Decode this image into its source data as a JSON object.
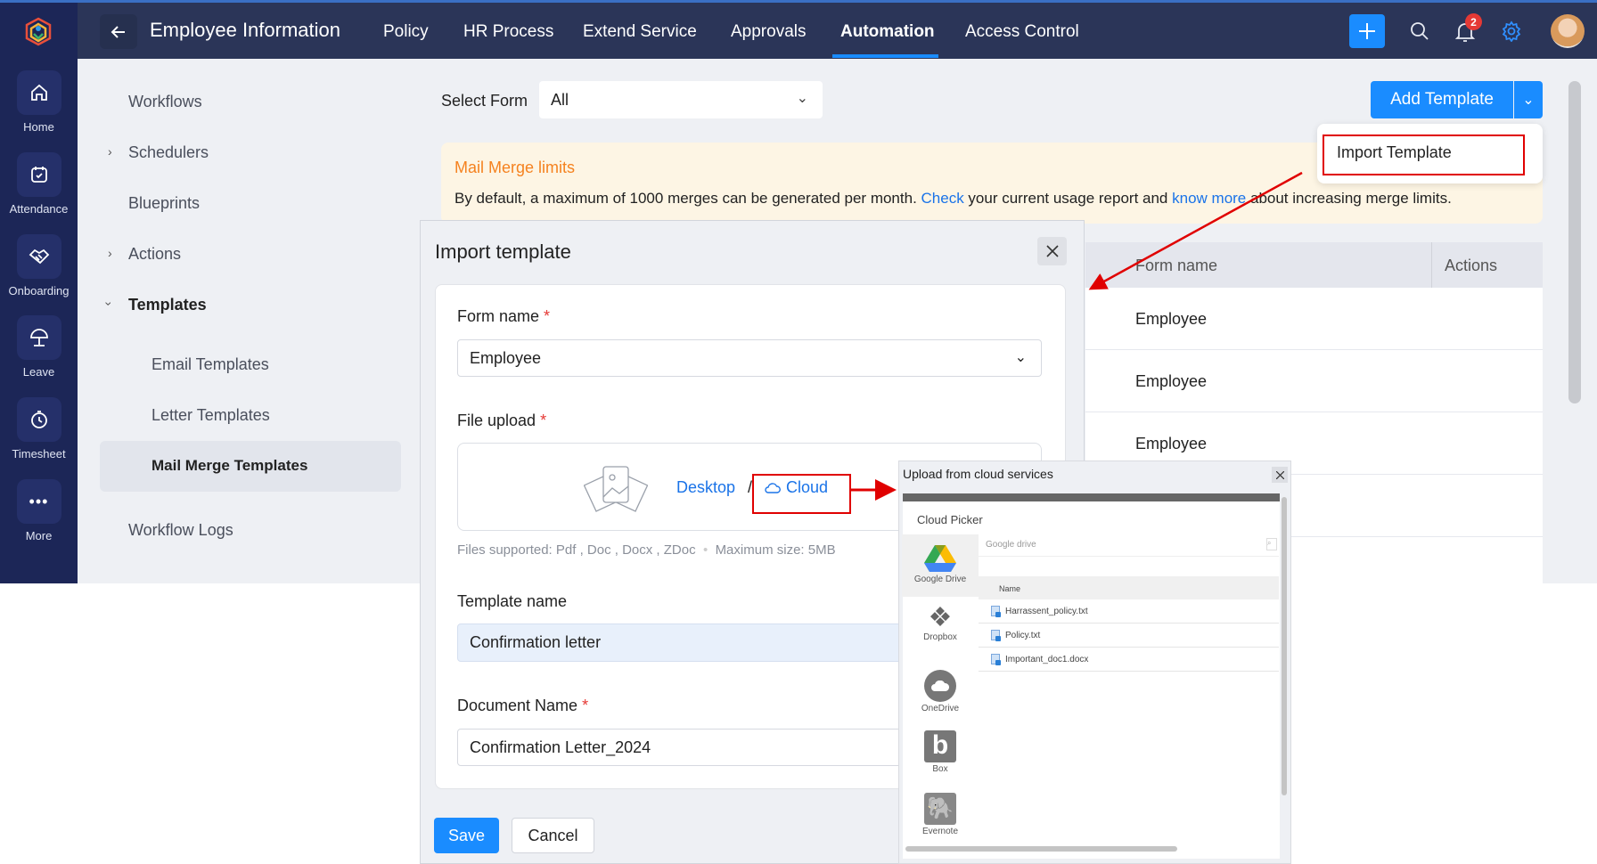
{
  "header": {
    "title": "Employee Information",
    "tabs": [
      {
        "label": "Policy"
      },
      {
        "label": "HR Process"
      },
      {
        "label": "Extend Service"
      },
      {
        "label": "Approvals"
      },
      {
        "label": "Automation",
        "active": true
      },
      {
        "label": "Access Control"
      }
    ],
    "notification_count": "2"
  },
  "rail": [
    {
      "label": "Home",
      "icon": "home-icon"
    },
    {
      "label": "Attendance",
      "icon": "calendar-check-icon"
    },
    {
      "label": "Onboarding",
      "icon": "handshake-icon"
    },
    {
      "label": "Leave",
      "icon": "umbrella-icon"
    },
    {
      "label": "Timesheet",
      "icon": "timer-icon"
    },
    {
      "label": "More",
      "icon": "more-icon"
    }
  ],
  "sidebar": {
    "items": [
      {
        "label": "Workflows"
      },
      {
        "label": "Schedulers"
      },
      {
        "label": "Blueprints"
      },
      {
        "label": "Actions"
      },
      {
        "label": "Templates"
      },
      {
        "label": "Email Templates"
      },
      {
        "label": "Letter Templates"
      },
      {
        "label": "Mail Merge Templates",
        "active": true
      },
      {
        "label": "Workflow Logs"
      }
    ]
  },
  "filter": {
    "label": "Select Form",
    "value": "All"
  },
  "actions": {
    "add_template": "Add Template",
    "menu": {
      "import_template": "Import Template"
    }
  },
  "banner": {
    "title": "Mail Merge limits",
    "text1": "By default, a maximum of 1000 merges can be generated per month. ",
    "link1": "Check",
    "text2": " your current usage report and ",
    "link2": "know more",
    "text3": " about increasing merge limits."
  },
  "table": {
    "columns": [
      "Form name",
      "Actions"
    ],
    "rows": [
      {
        "form": "Employee"
      },
      {
        "form": "Employee"
      },
      {
        "form": "Employee"
      }
    ]
  },
  "import_dialog": {
    "title": "Import template",
    "form_name_label": "Form name",
    "form_name_value": "Employee",
    "file_upload_label": "File upload",
    "desktop": "Desktop",
    "separator": "/",
    "cloud": "Cloud",
    "files_supported": "Files supported: Pdf , Doc , Docx , ZDoc",
    "max_size": "Maximum size: 5MB",
    "template_name_label": "Template name",
    "template_name_value": "Confirmation letter",
    "document_name_label": "Document Name",
    "document_name_value": "Confirmation Letter_2024",
    "save": "Save",
    "cancel": "Cancel",
    "required_mark": "*"
  },
  "cloud_dialog": {
    "title": "Upload from cloud services",
    "picker_title": "Cloud Picker",
    "search_placeholder": "Google drive",
    "name_column": "Name",
    "services": [
      {
        "label": "Google Drive"
      },
      {
        "label": "Dropbox"
      },
      {
        "label": "OneDrive"
      },
      {
        "label": "Box"
      },
      {
        "label": "Evernote"
      }
    ],
    "files": [
      {
        "name": "Harrassent_policy.txt"
      },
      {
        "name": "Policy.txt"
      },
      {
        "name": "Important_doc1.docx"
      }
    ]
  },
  "colors": {
    "accent": "#1a8cff",
    "topbar": "#2b3558",
    "rail": "#1c2657",
    "annotation": "#e00000",
    "banner_title": "#f5821f"
  }
}
